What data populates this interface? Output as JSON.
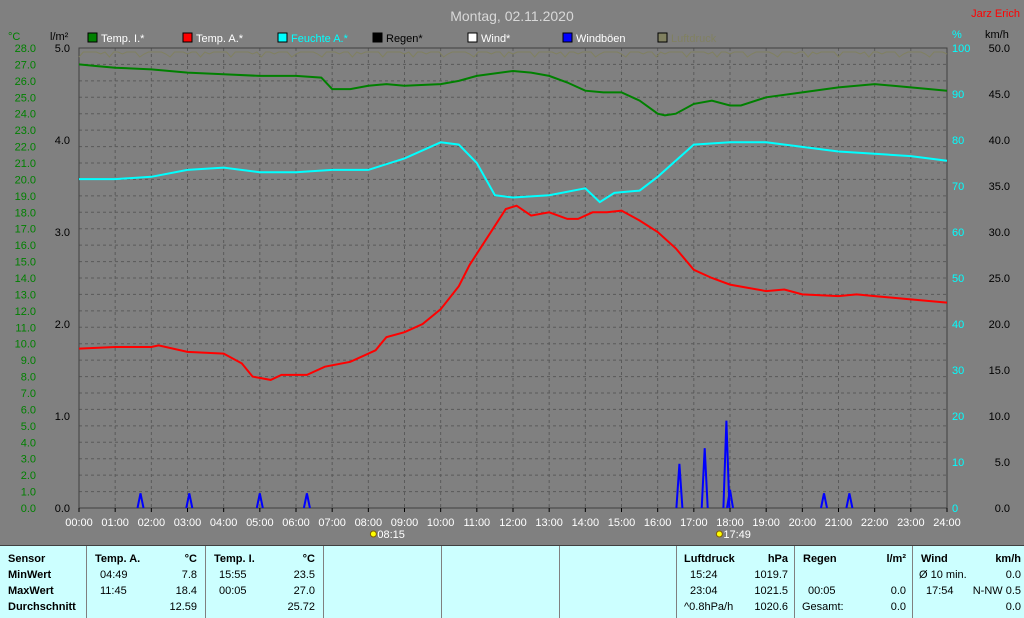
{
  "header": {
    "date_title": "Montag, 02.11.2020",
    "author": "Jarz Erich"
  },
  "legend": [
    {
      "label": "Temp. I.*",
      "color": "#008000"
    },
    {
      "label": "Temp. A.*",
      "color": "#ff0000"
    },
    {
      "label": "Feuchte A.*",
      "color": "#00ffff"
    },
    {
      "label": "Regen*",
      "color": "#000000"
    },
    {
      "label": "Wind*",
      "color": "#ffffff"
    },
    {
      "label": "Windböen",
      "color": "#0000ff"
    },
    {
      "label": "Luftdruck",
      "color": "#808060"
    }
  ],
  "axes": {
    "temp_unit": "°C",
    "rain_unit": "l/m²",
    "hum_unit": "%",
    "wind_unit": "km/h",
    "temp_ticks": [
      "28.0",
      "27.0",
      "26.0",
      "25.0",
      "24.0",
      "23.0",
      "22.0",
      "21.0",
      "20.0",
      "19.0",
      "18.0",
      "17.0",
      "16.0",
      "15.0",
      "14.0",
      "13.0",
      "12.0",
      "11.0",
      "10.0",
      "9.0",
      "8.0",
      "7.0",
      "6.0",
      "5.0",
      "4.0",
      "3.0",
      "2.0",
      "1.0",
      "0.0"
    ],
    "rain_ticks": [
      "5.0",
      "4.0",
      "3.0",
      "2.0",
      "1.0",
      "0.0"
    ],
    "hum_ticks": [
      "100",
      "90",
      "80",
      "70",
      "60",
      "50",
      "40",
      "30",
      "20",
      "10",
      "0"
    ],
    "wind_ticks": [
      "50.0",
      "45.0",
      "40.0",
      "35.0",
      "30.0",
      "25.0",
      "20.0",
      "15.0",
      "10.0",
      "5.0",
      "0.0"
    ],
    "time_ticks": [
      "00:00",
      "01:00",
      "02:00",
      "03:00",
      "04:00",
      "05:00",
      "06:00",
      "07:00",
      "08:00",
      "09:00",
      "10:00",
      "11:00",
      "12:00",
      "13:00",
      "14:00",
      "15:00",
      "16:00",
      "17:00",
      "18:00",
      "19:00",
      "20:00",
      "21:00",
      "22:00",
      "23:00",
      "24:00"
    ],
    "sunrise": "08:15",
    "sunset": "17:49"
  },
  "chart_data": {
    "type": "line",
    "title": "Montag, 02.11.2020",
    "x_range_hours": [
      0,
      24
    ],
    "temp_range": [
      0,
      28
    ],
    "rain_range": [
      0,
      5
    ],
    "hum_range": [
      0,
      100
    ],
    "wind_range": [
      0,
      50
    ],
    "grid": true,
    "series": [
      {
        "name": "Temp. I.*",
        "axis": "temp",
        "color": "#008000",
        "points": [
          [
            0,
            27.0
          ],
          [
            0.5,
            26.9
          ],
          [
            1,
            26.8
          ],
          [
            2,
            26.7
          ],
          [
            3,
            26.5
          ],
          [
            4,
            26.4
          ],
          [
            5,
            26.3
          ],
          [
            6,
            26.3
          ],
          [
            6.7,
            26.2
          ],
          [
            7,
            25.5
          ],
          [
            7.5,
            25.5
          ],
          [
            8,
            25.7
          ],
          [
            8.5,
            25.8
          ],
          [
            9,
            25.7
          ],
          [
            10,
            25.8
          ],
          [
            10.5,
            26.0
          ],
          [
            11,
            26.3
          ],
          [
            12,
            26.6
          ],
          [
            12.5,
            26.5
          ],
          [
            13,
            26.3
          ],
          [
            13.5,
            25.9
          ],
          [
            14,
            25.4
          ],
          [
            14.5,
            25.3
          ],
          [
            15,
            25.3
          ],
          [
            15.5,
            24.8
          ],
          [
            16,
            24.0
          ],
          [
            16.2,
            23.9
          ],
          [
            16.5,
            24.0
          ],
          [
            17,
            24.6
          ],
          [
            17.5,
            24.8
          ],
          [
            18,
            24.5
          ],
          [
            18.3,
            24.5
          ],
          [
            19,
            25.0
          ],
          [
            20,
            25.3
          ],
          [
            21,
            25.6
          ],
          [
            22,
            25.8
          ],
          [
            23,
            25.6
          ],
          [
            24,
            25.4
          ]
        ]
      },
      {
        "name": "Temp. A.*",
        "axis": "temp",
        "color": "#ff0000",
        "points": [
          [
            0,
            9.7
          ],
          [
            1,
            9.8
          ],
          [
            2,
            9.8
          ],
          [
            2.2,
            9.9
          ],
          [
            3,
            9.5
          ],
          [
            4,
            9.4
          ],
          [
            4.5,
            8.8
          ],
          [
            4.8,
            8.0
          ],
          [
            5.3,
            7.8
          ],
          [
            5.6,
            8.1
          ],
          [
            6.3,
            8.1
          ],
          [
            6.8,
            8.6
          ],
          [
            7.5,
            8.9
          ],
          [
            8.2,
            9.6
          ],
          [
            8.5,
            10.4
          ],
          [
            9,
            10.7
          ],
          [
            9.5,
            11.2
          ],
          [
            10,
            12.1
          ],
          [
            10.5,
            13.5
          ],
          [
            10.8,
            14.8
          ],
          [
            11.3,
            16.5
          ],
          [
            11.8,
            18.2
          ],
          [
            12.1,
            18.4
          ],
          [
            12.5,
            17.8
          ],
          [
            13,
            18.0
          ],
          [
            13.5,
            17.6
          ],
          [
            13.8,
            17.6
          ],
          [
            14.2,
            18.0
          ],
          [
            14.6,
            18.0
          ],
          [
            15,
            18.1
          ],
          [
            15.5,
            17.5
          ],
          [
            16,
            16.8
          ],
          [
            16.5,
            15.8
          ],
          [
            17,
            14.5
          ],
          [
            17.5,
            14.0
          ],
          [
            18,
            13.6
          ],
          [
            18.5,
            13.4
          ],
          [
            19,
            13.2
          ],
          [
            19.5,
            13.3
          ],
          [
            20,
            13.0
          ],
          [
            21,
            12.9
          ],
          [
            21.5,
            13.0
          ],
          [
            22,
            12.9
          ],
          [
            23,
            12.7
          ],
          [
            24,
            12.5
          ]
        ]
      },
      {
        "name": "Feuchte A.*",
        "axis": "hum",
        "color": "#00ffff",
        "points": [
          [
            0,
            71.5
          ],
          [
            1,
            71.5
          ],
          [
            2,
            72
          ],
          [
            3,
            73.5
          ],
          [
            4,
            74
          ],
          [
            5,
            73
          ],
          [
            6,
            73
          ],
          [
            7,
            73.5
          ],
          [
            8,
            73.5
          ],
          [
            9,
            76
          ],
          [
            10,
            79.5
          ],
          [
            10.5,
            79
          ],
          [
            11,
            75
          ],
          [
            11.5,
            68
          ],
          [
            12,
            67.5
          ],
          [
            13,
            68
          ],
          [
            14,
            69.5
          ],
          [
            14.4,
            66.5
          ],
          [
            14.8,
            68.5
          ],
          [
            15.5,
            69
          ],
          [
            16,
            72
          ],
          [
            17,
            79
          ],
          [
            18,
            79.5
          ],
          [
            19,
            79.5
          ],
          [
            20,
            78.5
          ],
          [
            21,
            77.5
          ],
          [
            22,
            77
          ],
          [
            23,
            76.5
          ],
          [
            24,
            75.5
          ]
        ]
      },
      {
        "name": "Windböen",
        "axis": "wind",
        "color": "#0000ff",
        "spikes": [
          [
            1.7,
            1.6
          ],
          [
            3.05,
            1.6
          ],
          [
            5.0,
            1.6
          ],
          [
            6.3,
            1.6
          ],
          [
            16.6,
            4.8
          ],
          [
            17.3,
            6.5
          ],
          [
            17.9,
            9.5
          ],
          [
            18.0,
            2.0
          ],
          [
            20.6,
            1.6
          ],
          [
            21.3,
            1.6
          ]
        ]
      }
    ]
  },
  "table": {
    "sensor": {
      "head": "Sensor",
      "rows": [
        "MinWert",
        "MaxWert",
        "Durchschnitt"
      ]
    },
    "temp_a": {
      "head": "Temp. A.",
      "unit": "°C",
      "min_time": "04:49",
      "min": "7.8",
      "max_time": "11:45",
      "max": "18.4",
      "avg": "12.59"
    },
    "temp_i": {
      "head": "Temp. I.",
      "unit": "°C",
      "min_time": "15:55",
      "min": "23.5",
      "max_time": "00:05",
      "max": "27.0",
      "avg": "25.72"
    },
    "pressure": {
      "head": "Luftdruck",
      "unit": "hPa",
      "min_time": "15:24",
      "min": "1019.7",
      "max_time": "23:04",
      "max": "1021.5",
      "trend": "^0.8hPa/h",
      "avg": "1020.6"
    },
    "rain": {
      "head": "Regen",
      "unit": "l/m²",
      "max_time": "00:05",
      "max": "0.0",
      "total_label": "Gesamt:",
      "total": "0.0"
    },
    "wind": {
      "head": "Wind",
      "unit": "km/h",
      "min_label": "Ø 10 min.",
      "min": "0.0",
      "max_time": "17:54",
      "max": "N-NW 0.5",
      "avg": "0.0"
    }
  }
}
